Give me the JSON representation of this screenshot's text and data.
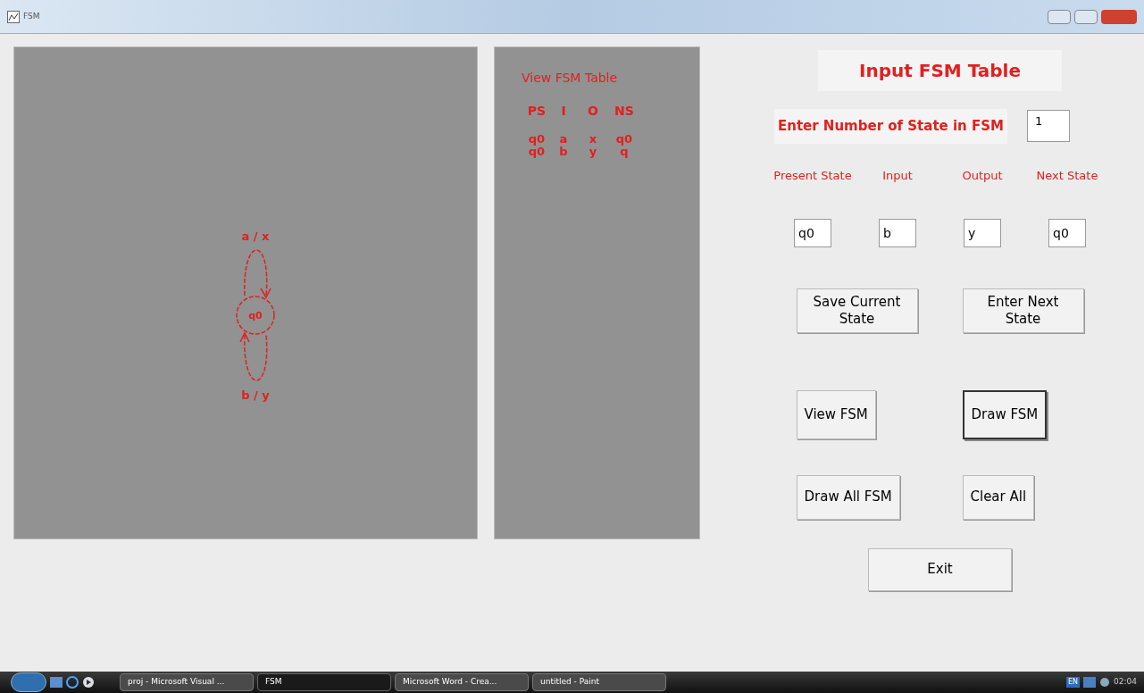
{
  "window": {
    "title": "FSM"
  },
  "diagram": {
    "state": "q0",
    "loops": [
      {
        "kind": "top",
        "label": "a / x"
      },
      {
        "kind": "bottom",
        "label": "b / y"
      }
    ]
  },
  "table": {
    "title": "View FSM Table",
    "columns": [
      "PS",
      "I",
      "O",
      "NS"
    ],
    "rows": [
      [
        "q0",
        "a",
        "x",
        "q0"
      ],
      [
        "q0",
        "b",
        "y",
        "q"
      ]
    ]
  },
  "form": {
    "heading": "Input FSM Table",
    "count_label": "Enter Number of State in FSM",
    "count_value": "1",
    "fields": [
      {
        "label": "Present State",
        "value": "q0"
      },
      {
        "label": "Input",
        "value": "b"
      },
      {
        "label": "Output",
        "value": "y"
      },
      {
        "label": "Next State",
        "value": "q0"
      }
    ],
    "button_rows": [
      [
        {
          "label": "Save Current State",
          "focused": false
        },
        {
          "label": "Enter Next State",
          "focused": false
        }
      ],
      [
        {
          "label": "View FSM",
          "focused": false
        },
        {
          "label": "Draw FSM",
          "focused": true
        }
      ],
      [
        {
          "label": "Draw All FSM",
          "focused": false
        },
        {
          "label": "Clear All",
          "focused": false
        }
      ]
    ],
    "exit": "Exit"
  },
  "taskbar": {
    "items": [
      {
        "label": "proj - Microsoft Visual ...",
        "selected": false
      },
      {
        "label": "FSM",
        "selected": true
      },
      {
        "label": "Microsoft Word - Crea...",
        "selected": false
      },
      {
        "label": "untitled - Paint",
        "selected": false
      }
    ],
    "language": "EN",
    "clock": "02:04"
  }
}
